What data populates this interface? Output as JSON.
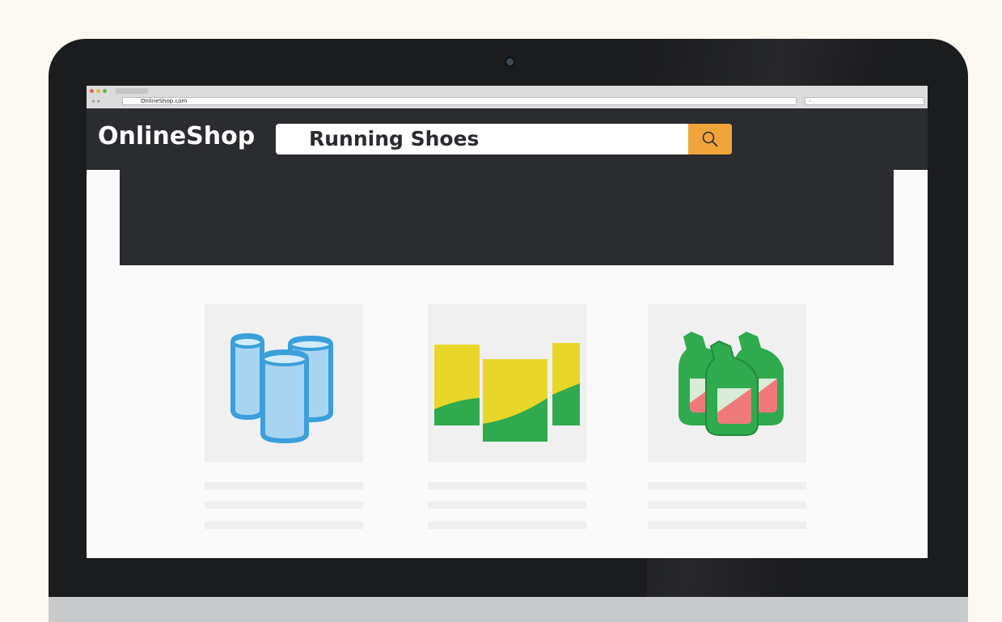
{
  "browser": {
    "url": "OnlineShop.com",
    "nav_arrows": "◂ ▸",
    "search_icon": "⌕"
  },
  "site": {
    "logo": "OnlineShop",
    "search_query": "Running Shoes",
    "search_button_icon": "search-icon"
  },
  "products": [
    {
      "icon": "cans-icon",
      "colors": {
        "fill": "#a9d4ef",
        "stroke": "#3a9fdb"
      }
    },
    {
      "icon": "boxes-icon",
      "colors": {
        "top": "#e8d72a",
        "bottom": "#2faa4f"
      }
    },
    {
      "icon": "bottles-icon",
      "colors": {
        "body": "#2faa4f",
        "label": "#f08b8b"
      }
    }
  ],
  "colors": {
    "header_bg": "#2a2c30",
    "accent": "#f0a43a",
    "screen_bg": "#fafafa"
  }
}
